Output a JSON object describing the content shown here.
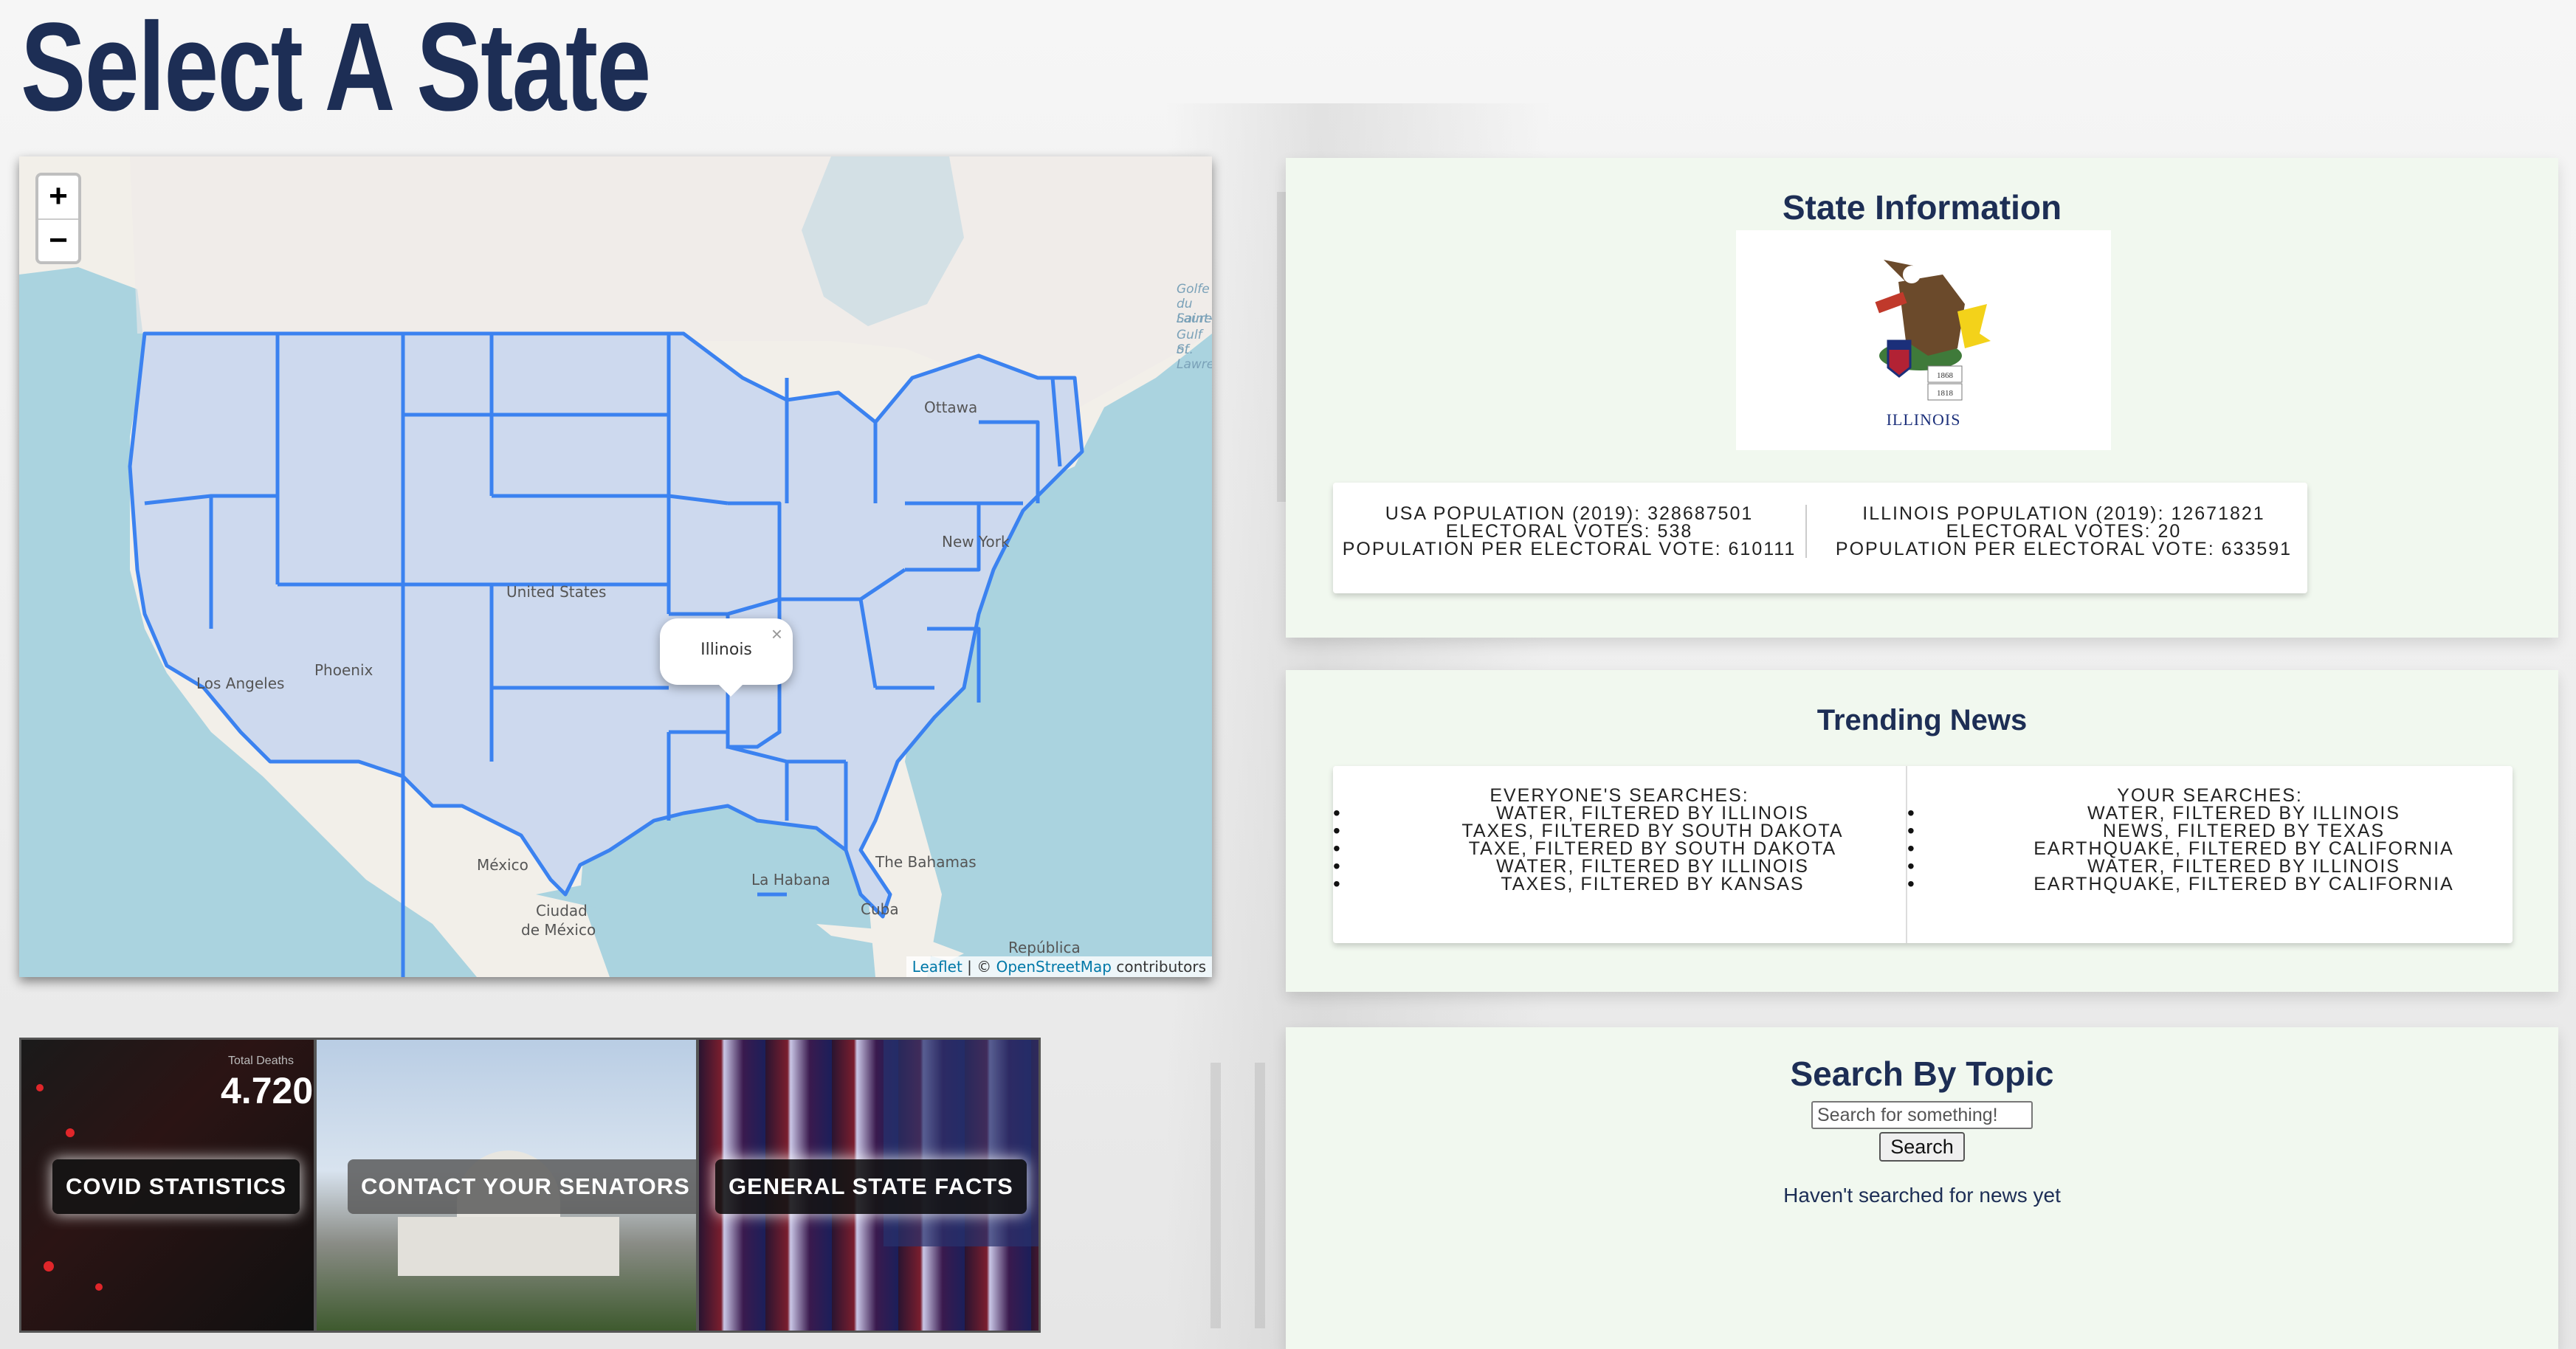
{
  "page": {
    "title": "Select A State"
  },
  "map": {
    "zoom_in": "+",
    "zoom_out": "−",
    "popup_text": "Illinois",
    "popup_close": "×",
    "labels": {
      "country": "United States",
      "ottawa": "Ottawa",
      "newyork": "New York",
      "losangeles": "Los Angeles",
      "phoenix": "Phoenix",
      "mexico": "México",
      "ciudad1": "Ciudad",
      "ciudad2": "de México",
      "habana": "La Habana",
      "cuba": "Cuba",
      "bahamas": "The Bahamas",
      "republica": "República",
      "golfe": [
        "Golfe",
        "du Saint-",
        "Laurent",
        "Gulf of",
        "St. Lawrence"
      ]
    },
    "attribution": {
      "leaflet": "Leaflet",
      "sep": " | © ",
      "osm": "OpenStreetMap",
      "tail": " contributors"
    }
  },
  "tiles": [
    {
      "label": "COVID STATISTICS",
      "overlay_number": "4.720",
      "overlay_caption": "Total Deaths"
    },
    {
      "label": "CONTACT YOUR SENATORS"
    },
    {
      "label": "GENERAL STATE FACTS"
    }
  ],
  "state_info": {
    "heading": "State Information",
    "flag_caption": "ILLINOIS",
    "flag_years": [
      "1868",
      "1818"
    ],
    "usa": {
      "line1": "USA POPULATION (2019): 328687501",
      "line2": "ELECTORAL VOTES: 538",
      "line3": "POPULATION PER ELECTORAL VOTE: 610111"
    },
    "state": {
      "line1": "ILLINOIS POPULATION (2019): 12671821",
      "line2": "ELECTORAL VOTES: 20",
      "line3": "POPULATION PER ELECTORAL VOTE: 633591"
    }
  },
  "trending": {
    "heading": "Trending News",
    "everyone_heading": "EVERYONE'S SEARCHES:",
    "everyone": [
      "WATER, FILTERED BY ILLINOIS",
      "TAXES, FILTERED BY SOUTH DAKOTA",
      "TAXE, FILTERED BY SOUTH DAKOTA",
      "WATER, FILTERED BY ILLINOIS",
      "TAXES, FILTERED BY KANSAS"
    ],
    "yours_heading": "YOUR SEARCHES:",
    "yours": [
      "WATER, FILTERED BY ILLINOIS",
      "NEWS, FILTERED BY TEXAS",
      "EARTHQUAKE, FILTERED BY CALIFORNIA",
      "WATER, FILTERED BY ILLINOIS",
      "EARTHQUAKE, FILTERED BY CALIFORNIA"
    ]
  },
  "search": {
    "heading": "Search By Topic",
    "placeholder": "Search for something!",
    "button": "Search",
    "empty": "Haven't searched for news yet"
  },
  "colors": {
    "title": "#1d2e55",
    "state_fill": "#cdd9ee",
    "state_stroke": "#3b82f0",
    "water": "#aad3df",
    "panel": "#f1f8ef"
  }
}
